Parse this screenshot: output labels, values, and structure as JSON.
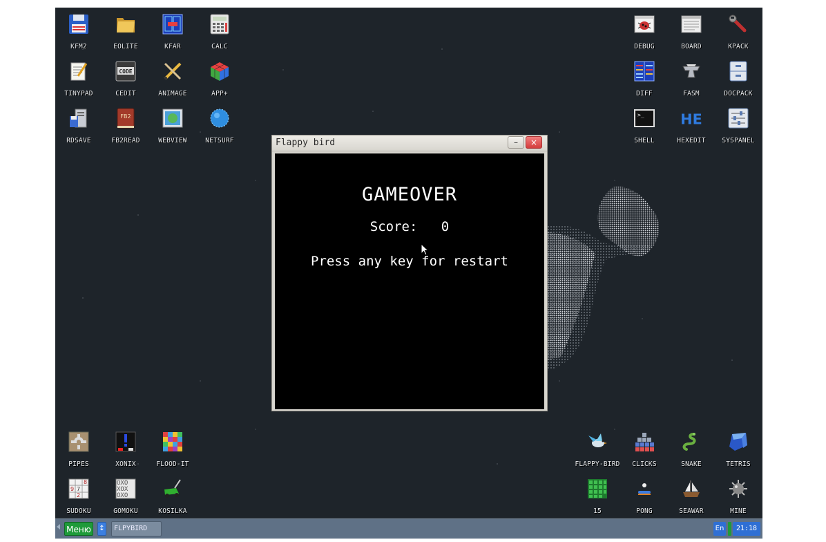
{
  "desktop": {
    "icons_top_left": [
      {
        "label": "KFM2",
        "icon": "floppy-icon"
      },
      {
        "label": "EOLITE",
        "icon": "folder-icon"
      },
      {
        "label": "KFAR",
        "icon": "panels-icon"
      },
      {
        "label": "CALC",
        "icon": "calculator-icon"
      },
      {
        "label": "TINYPAD",
        "icon": "notepad-icon"
      },
      {
        "label": "CEDIT",
        "icon": "code-icon"
      },
      {
        "label": "ANIMAGE",
        "icon": "pencil-icon"
      },
      {
        "label": "APP+",
        "icon": "cube-icon"
      },
      {
        "label": "RDSAVE",
        "icon": "rdsave-icon"
      },
      {
        "label": "FB2READ",
        "icon": "book-icon"
      },
      {
        "label": "WEBVIEW",
        "icon": "webview-icon"
      },
      {
        "label": "NETSURF",
        "icon": "globe-icon"
      }
    ],
    "icons_top_right": [
      {
        "label": "DEBUG",
        "icon": "bug-icon"
      },
      {
        "label": "BOARD",
        "icon": "board-icon"
      },
      {
        "label": "KPACK",
        "icon": "wrench-icon"
      },
      {
        "label": "DIFF",
        "icon": "diff-icon"
      },
      {
        "label": "FASM",
        "icon": "anvil-icon"
      },
      {
        "label": "DOCPACK",
        "icon": "cabinet-icon"
      },
      {
        "label": "SHELL",
        "icon": "terminal-icon"
      },
      {
        "label": "HEXEDIT",
        "icon": "hex-icon"
      },
      {
        "label": "SYSPANEL",
        "icon": "sliders-icon"
      }
    ],
    "icons_bottom_left": [
      {
        "label": "PIPES",
        "icon": "pipes-icon"
      },
      {
        "label": "XONIX",
        "icon": "xonix-icon"
      },
      {
        "label": "FLOOD-IT",
        "icon": "flood-icon"
      },
      {
        "label": "SUDOKU",
        "icon": "sudoku-icon"
      },
      {
        "label": "GOMOKU",
        "icon": "gomoku-icon"
      },
      {
        "label": "KOSILKA",
        "icon": "mower-icon"
      }
    ],
    "icons_bottom_right": [
      {
        "label": "FLAPPY-BIRD",
        "icon": "bird-icon"
      },
      {
        "label": "CLICKS",
        "icon": "blocks-icon"
      },
      {
        "label": "SNAKE",
        "icon": "snake-icon"
      },
      {
        "label": "TETRIS",
        "icon": "tetris-icon"
      },
      {
        "label": "15",
        "icon": "fifteen-icon"
      },
      {
        "label": "PONG",
        "icon": "pong-icon"
      },
      {
        "label": "SEAWAR",
        "icon": "ship-icon"
      },
      {
        "label": "MINE",
        "icon": "mine-icon"
      }
    ]
  },
  "window": {
    "title": "Flappy bird",
    "minimize": "–",
    "close": "×",
    "game": {
      "heading": "GAMEOVER",
      "score_label": "Score:",
      "score_value": "0",
      "hint": "Press any key for restart"
    }
  },
  "taskbar": {
    "menu": "Меню",
    "switch": "↕",
    "task": "FLPYBIRD",
    "lang": "En",
    "clock": "21:18"
  },
  "colors": {
    "desktop_bg": "#1e242a",
    "taskbar_bg": "#5f7186",
    "menu_green": "#1f9a3a",
    "accent_blue": "#2f6fd4",
    "close_red": "#d43d3d"
  }
}
